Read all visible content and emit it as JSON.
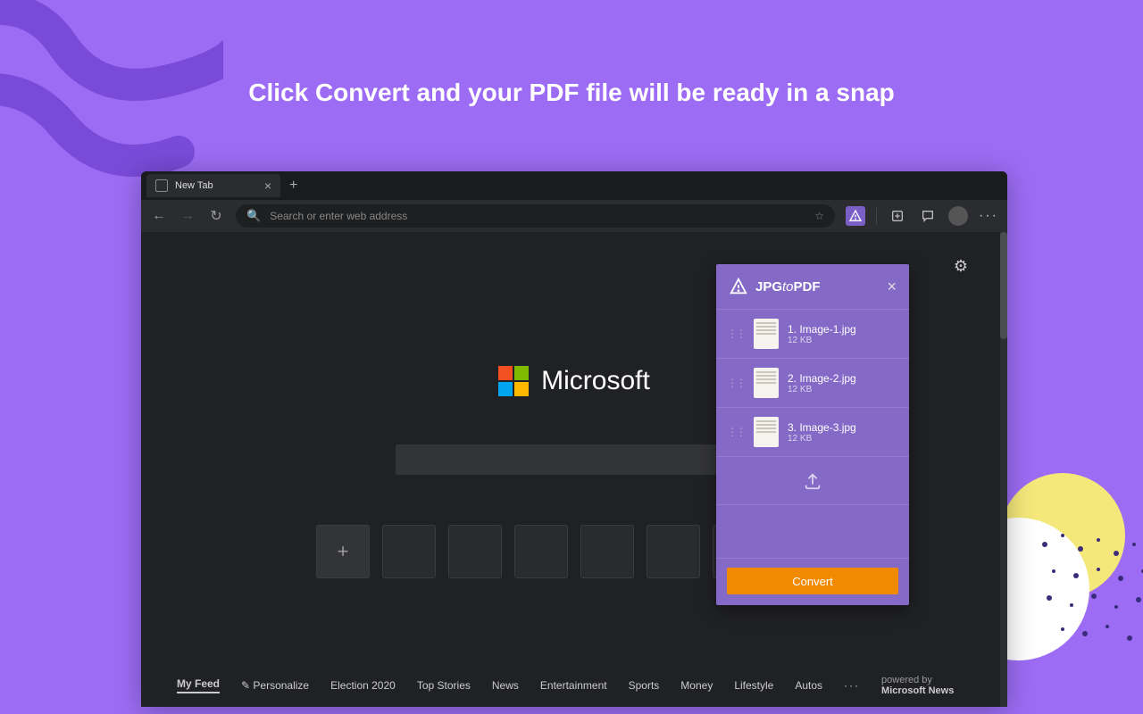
{
  "promo": {
    "headline": "Click Convert and your PDF file will be ready in a snap"
  },
  "browser": {
    "tab": {
      "title": "New Tab"
    },
    "addressbar": {
      "placeholder": "Search or enter web address"
    },
    "content": {
      "brand": "Microsoft",
      "feed": {
        "active": "My Feed",
        "personalize": "Personalize",
        "links": [
          "Election 2020",
          "Top Stories",
          "News",
          "Entertainment",
          "Sports",
          "Money",
          "Lifestyle",
          "Autos"
        ],
        "powered_prefix": "powered by ",
        "powered_brand": "Microsoft News"
      }
    }
  },
  "extension": {
    "title_part1": "JPG",
    "title_part2": "to",
    "title_part3": "PDF",
    "files": [
      {
        "name": "1. Image-1.jpg",
        "size": "12 KB"
      },
      {
        "name": "2. Image-2.jpg",
        "size": "12 KB"
      },
      {
        "name": "3. Image-3.jpg",
        "size": "12 KB"
      }
    ],
    "convert_label": "Convert",
    "colors": {
      "panel": "#8469c6",
      "button": "#f18a00"
    }
  }
}
